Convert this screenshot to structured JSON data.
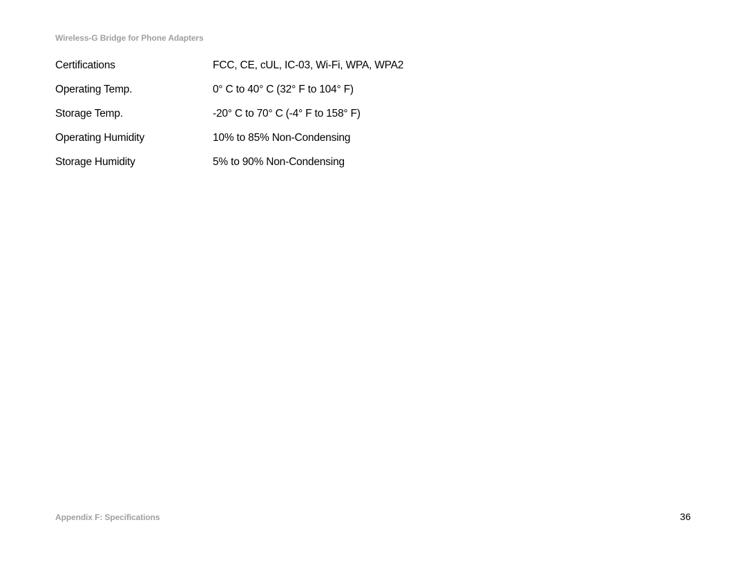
{
  "header": {
    "title": "Wireless-G Bridge for Phone Adapters"
  },
  "specs": [
    {
      "label": "Certifications",
      "value": "FCC, CE, cUL, IC-03, Wi-Fi, WPA, WPA2"
    },
    {
      "label": "Operating Temp.",
      "value": "0° C to 40° C (32° F to 104° F)"
    },
    {
      "label": "Storage Temp.",
      "value": "-20° C to 70° C (-4° F to 158° F)"
    },
    {
      "label": "Operating Humidity",
      "value": "10% to 85% Non-Condensing"
    },
    {
      "label": "Storage Humidity",
      "value": "5% to 90% Non-Condensing"
    }
  ],
  "footer": {
    "appendix": "Appendix F: Specifications",
    "page_number": "36"
  }
}
